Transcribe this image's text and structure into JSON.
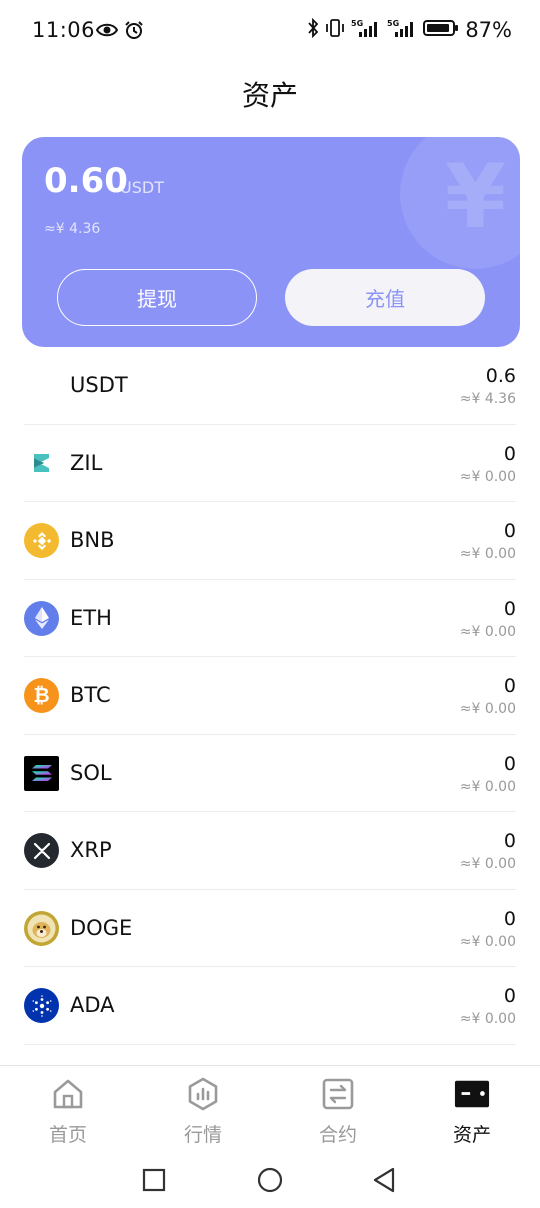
{
  "status_bar": {
    "time": "11:06",
    "battery": "87%",
    "icons": [
      "eye-icon",
      "alarm-icon",
      "bluetooth-icon",
      "vibrate-icon",
      "signal-5g-icon",
      "signal-5g-icon",
      "battery-icon"
    ]
  },
  "page": {
    "title": "资产"
  },
  "card": {
    "amount": "0.60",
    "unit": "USDT",
    "cny": "≈¥ 4.36",
    "withdraw_label": "提现",
    "deposit_label": "充值",
    "background_color": "#8b93f7"
  },
  "coins": [
    {
      "name": "USDT",
      "amount": "0.6",
      "value": "≈¥ 4.36",
      "icon": "none"
    },
    {
      "name": "ZIL",
      "amount": "0",
      "value": "≈¥ 0.00",
      "icon": "zil-icon",
      "color": "#49c1bf"
    },
    {
      "name": "BNB",
      "amount": "0",
      "value": "≈¥ 0.00",
      "icon": "bnb-icon",
      "color": "#f3ba2f"
    },
    {
      "name": "ETH",
      "amount": "0",
      "value": "≈¥ 0.00",
      "icon": "eth-icon",
      "color": "#627eea"
    },
    {
      "name": "BTC",
      "amount": "0",
      "value": "≈¥ 0.00",
      "icon": "btc-icon",
      "color": "#f7931a"
    },
    {
      "name": "SOL",
      "amount": "0",
      "value": "≈¥ 0.00",
      "icon": "sol-icon",
      "color": "#000000"
    },
    {
      "name": "XRP",
      "amount": "0",
      "value": "≈¥ 0.00",
      "icon": "xrp-icon",
      "color": "#23292f"
    },
    {
      "name": "DOGE",
      "amount": "0",
      "value": "≈¥ 0.00",
      "icon": "doge-icon",
      "color": "#c2a633"
    },
    {
      "name": "ADA",
      "amount": "0",
      "value": "≈¥ 0.00",
      "icon": "ada-icon",
      "color": "#0033ad"
    }
  ],
  "bottom_nav": [
    {
      "label": "首页",
      "icon": "home-icon",
      "active": false
    },
    {
      "label": "行情",
      "icon": "market-icon",
      "active": false
    },
    {
      "label": "合约",
      "icon": "contract-icon",
      "active": false
    },
    {
      "label": "资产",
      "icon": "wallet-icon",
      "active": true
    }
  ]
}
